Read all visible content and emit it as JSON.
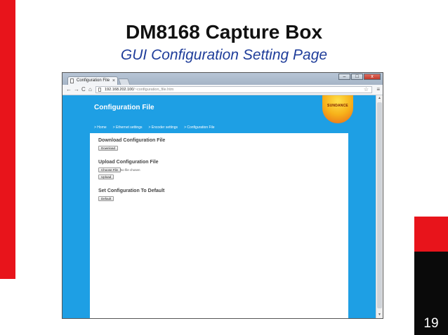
{
  "slide": {
    "title": "DM8168 Capture Box",
    "subtitle": "GUI Configuration Setting Page",
    "page_number": "19"
  },
  "browser": {
    "tab_title": "Configuration File",
    "tab_close": "×",
    "url_host": "192.168.202.100",
    "url_path": "/~configuration_file.htm",
    "nav_back": "←",
    "nav_forward": "→",
    "nav_reload": "C",
    "nav_home": "⌂",
    "star": "☆",
    "menu": "≡",
    "win_minimize": "–",
    "win_maximize": "□",
    "win_close": "x"
  },
  "page": {
    "header_title": "Configuration File",
    "logo_text": "SUNDANCE",
    "nav": [
      "> Home",
      "> Ethernet settings",
      "> Encoder settings",
      "> Configuration File"
    ],
    "download": {
      "title": "Download Configuration File",
      "button": "Download"
    },
    "upload": {
      "title": "Upload Configuration File",
      "choose_button": "Choose File",
      "file_status": "No file chosen",
      "upload_button": "Upload"
    },
    "default": {
      "title": "Set Configuration To Default",
      "button": "Default"
    }
  },
  "colors": {
    "accent_red": "#e8141b",
    "page_blue": "#1e9fe4",
    "subtitle_blue": "#1f3d9a"
  },
  "icons": {
    "tab": "page-icon",
    "back": "arrow-left-icon",
    "forward": "arrow-right-icon",
    "reload": "reload-icon",
    "home": "home-icon",
    "bookmark": "star-icon",
    "menu": "menu-icon"
  }
}
